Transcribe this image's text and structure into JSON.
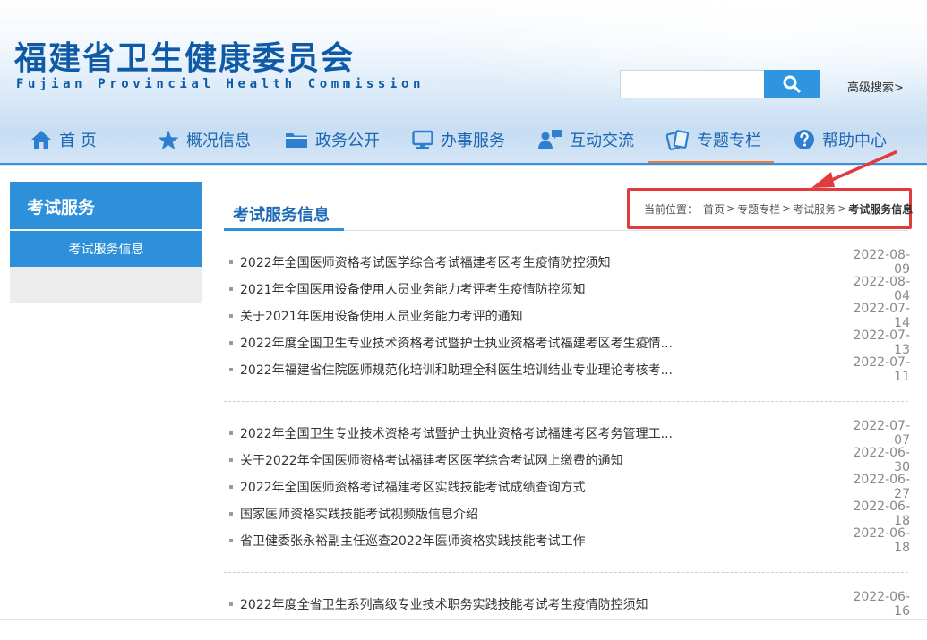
{
  "header": {
    "title": "福建省卫生健康委员会",
    "subtitle": "Fujian Provincial Health Commission",
    "search_placeholder": "",
    "advanced_search": "高级搜索>"
  },
  "nav": {
    "items": [
      {
        "label": "首 页",
        "icon": "home-icon"
      },
      {
        "label": "概况信息",
        "icon": "star-icon"
      },
      {
        "label": "政务公开",
        "icon": "folder-icon"
      },
      {
        "label": "办事服务",
        "icon": "monitor-icon"
      },
      {
        "label": "互动交流",
        "icon": "people-chat-icon"
      },
      {
        "label": "专题专栏",
        "icon": "cards-icon"
      },
      {
        "label": "帮助中心",
        "icon": "help-icon"
      }
    ],
    "active_index": 5
  },
  "sidebar": {
    "title": "考试服务",
    "items": [
      {
        "label": "考试服务信息"
      }
    ]
  },
  "main": {
    "title": "考试服务信息",
    "breadcrumb": {
      "prefix": "当前位置：",
      "items": [
        "首页",
        "专题专栏",
        "考试服务",
        "考试服务信息"
      ],
      "separator": ">"
    },
    "news": [
      {
        "title": "2022年全国医师资格考试医学综合考试福建考区考生疫情防控须知",
        "date": "2022-08-09"
      },
      {
        "title": "2021年全国医用设备使用人员业务能力考评考生疫情防控须知",
        "date": "2022-08-04"
      },
      {
        "title": "关于2021年医用设备使用人员业务能力考评的通知",
        "date": "2022-07-14"
      },
      {
        "title": "2022年度全国卫生专业技术资格考试暨护士执业资格考试福建考区考生疫情...",
        "date": "2022-07-13"
      },
      {
        "title": "2022年福建省住院医师规范化培训和助理全科医生培训结业专业理论考核考...",
        "date": "2022-07-11"
      },
      {
        "title": "2022年全国卫生专业技术资格考试暨护士执业资格考试福建考区考务管理工...",
        "date": "2022-07-07"
      },
      {
        "title": "关于2022年全国医师资格考试福建考区医学综合考试网上缴费的通知",
        "date": "2022-06-30"
      },
      {
        "title": "2022年全国医师资格考试福建考区实践技能考试成绩查询方式",
        "date": "2022-06-27"
      },
      {
        "title": "国家医师资格实践技能考试视频版信息介绍",
        "date": "2022-06-18"
      },
      {
        "title": "省卫健委张永裕副主任巡查2022年医师资格实践技能考试工作",
        "date": "2022-06-18"
      },
      {
        "title": "2022年度全省卫生系列高级专业技术职务实践技能考试考生疫情防控须知",
        "date": "2022-06-16"
      }
    ]
  },
  "colors": {
    "brand_blue": "#0f5aa6",
    "accent_blue": "#2e8fdb",
    "active_orange": "#f07c30",
    "highlight_red": "#e23b3b"
  }
}
